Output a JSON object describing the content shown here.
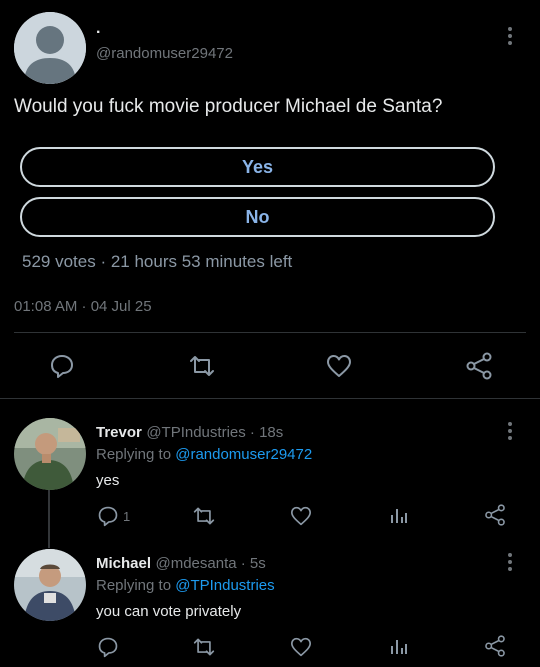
{
  "main_tweet": {
    "display_name": ".",
    "handle": "@randomuser29472",
    "text": "Would you fuck movie producer Michael de Santa?",
    "poll": {
      "options": [
        "Yes",
        "No"
      ],
      "summary": "529 votes · 21 hours 53 minutes left"
    },
    "timestamp": "01:08 AM · 04 Jul 25"
  },
  "replies": [
    {
      "name": "Trevor",
      "handle_time": "@TPIndustries · 18s",
      "replying_prefix": "Replying to",
      "replying_to": "@randomuser29472",
      "text": "yes",
      "reply_count": "1"
    },
    {
      "name": "Michael",
      "handle_time": "@mdesanta · 5s",
      "replying_prefix": "Replying to",
      "replying_to": "@TPIndustries",
      "text": "you can vote privately",
      "reply_count": ""
    }
  ],
  "colors": {
    "background": "#000000",
    "text": "#e7e9ea",
    "muted": "#71767b",
    "link": "#1d9bf0",
    "poll_border": "#cfd9de",
    "poll_label": "#8ab4e8"
  },
  "icons": [
    "more-icon",
    "reply-icon",
    "retweet-icon",
    "like-icon",
    "share-icon",
    "analytics-icon"
  ]
}
